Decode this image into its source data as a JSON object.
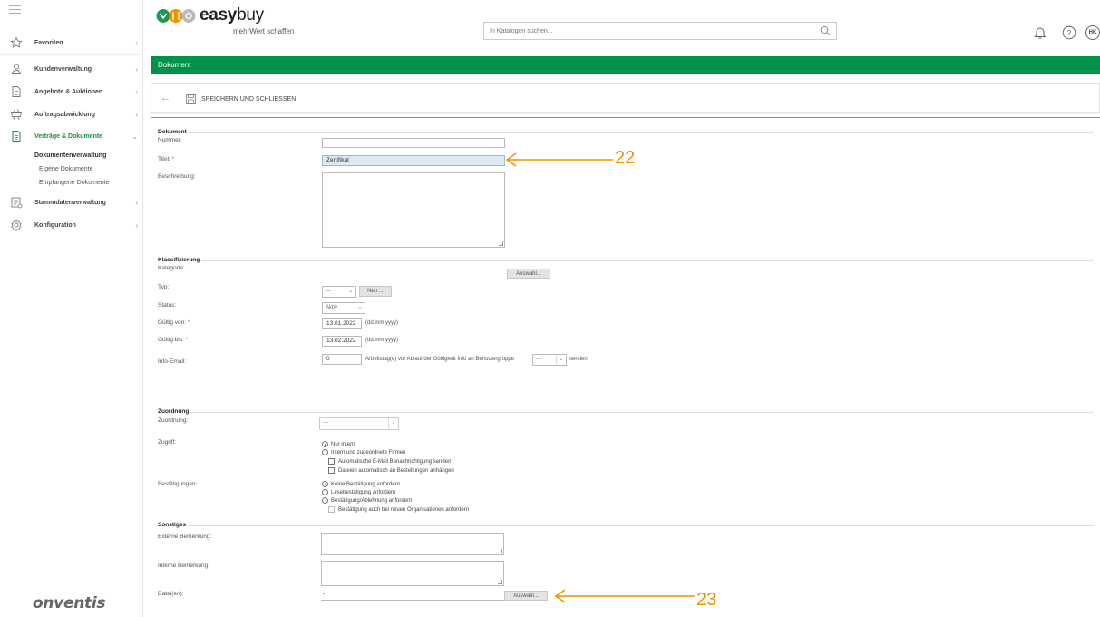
{
  "brand": {
    "name_bold": "easy",
    "name_light": "buy",
    "tagline": "mehrWert schaffen"
  },
  "search": {
    "placeholder": "In Katalogen suchen..."
  },
  "header": {
    "user_initials": "HK"
  },
  "sidebar": {
    "items": [
      {
        "label": "Favoriten",
        "icon": "star-icon"
      },
      {
        "label": "Kundenverwaltung",
        "icon": "user-icon"
      },
      {
        "label": "Angebote & Auktionen",
        "icon": "document-icon"
      },
      {
        "label": "Auftragsabwicklung",
        "icon": "cart-icon"
      },
      {
        "label": "Verträge & Dokumente",
        "icon": "contract-icon"
      },
      {
        "label": "Stammdatenverwaltung",
        "icon": "database-icon"
      },
      {
        "label": "Konfiguration",
        "icon": "gear-icon"
      }
    ],
    "sub": {
      "head": "Dokumentenverwaltung",
      "children": [
        "Eigene Dokumente",
        "Empfangene Dokumente"
      ]
    },
    "footer_logo": "onventis"
  },
  "page": {
    "title": "Dokument"
  },
  "toolbar": {
    "save_label": "SPEICHERN UND SCHLIESSEN"
  },
  "form": {
    "dokument": {
      "section": "Dokument",
      "nummer_label": "Nummer:",
      "nummer_value": "",
      "titel_label": "Titel:",
      "titel_value": "Zertifikat",
      "beschreibung_label": "Beschreibung:"
    },
    "klassifizierung": {
      "section": "Klassifizierung",
      "kategorie_label": "Kategorie:",
      "auswahl_button": "Auswahl...",
      "typ_label": "Typ:",
      "typ_value": "---",
      "neu_button": "Neu ...",
      "status_label": "Status:",
      "status_value": "Aktiv",
      "gueltig_von_label": "Gültig von:",
      "gueltig_von_value": "13.01.2022",
      "gueltig_bis_label": "Gültig bis:",
      "gueltig_bis_value": "13.02.2022",
      "date_hint": "(dd.mm.yyyy)",
      "info_email_label": "Info-Email:",
      "info_email_value": "0",
      "info_email_text": "Arbeitstag(e) vor Ablauf der Gültigkeit Info an Benutzergruppe",
      "info_group_value": "---",
      "senden": "senden"
    },
    "zuordnung": {
      "section": "Zuordnung",
      "zuordnung_label": "Zuordnung:",
      "zuordnung_value": "---",
      "zugriff_label": "Zugriff:",
      "zugriff_options": [
        "Nur intern",
        "Intern und zugeordnete Firmen"
      ],
      "zugriff_checks": [
        "Automatische E-Mail Benachrichtigung senden",
        "Dateien automatisch an Bestellungen anhängen"
      ],
      "bestaetigungen_label": "Bestätigungen:",
      "bestaetigungen_options": [
        "Keine Bestätigung anfordern",
        "Lesebestätigung anfordern",
        "Bestätigung/Ablehnung anfordern"
      ],
      "bestaetigungen_check": "Bestätigung auch bei neuen Organisationen anfordern"
    },
    "sonstiges": {
      "section": "Sonstiges",
      "extern_label": "Externe Bemerkung:",
      "intern_label": "Interne Bemerkung:",
      "dateien_label": "Datei(en):",
      "dateien_value": "-",
      "auswahl_button": "Auswahl..."
    }
  },
  "annotations": {
    "a1": "22",
    "a2": "23",
    "color": "#f39200"
  },
  "colors": {
    "accent": "#00914a",
    "highlight": "#dfe8f5"
  }
}
